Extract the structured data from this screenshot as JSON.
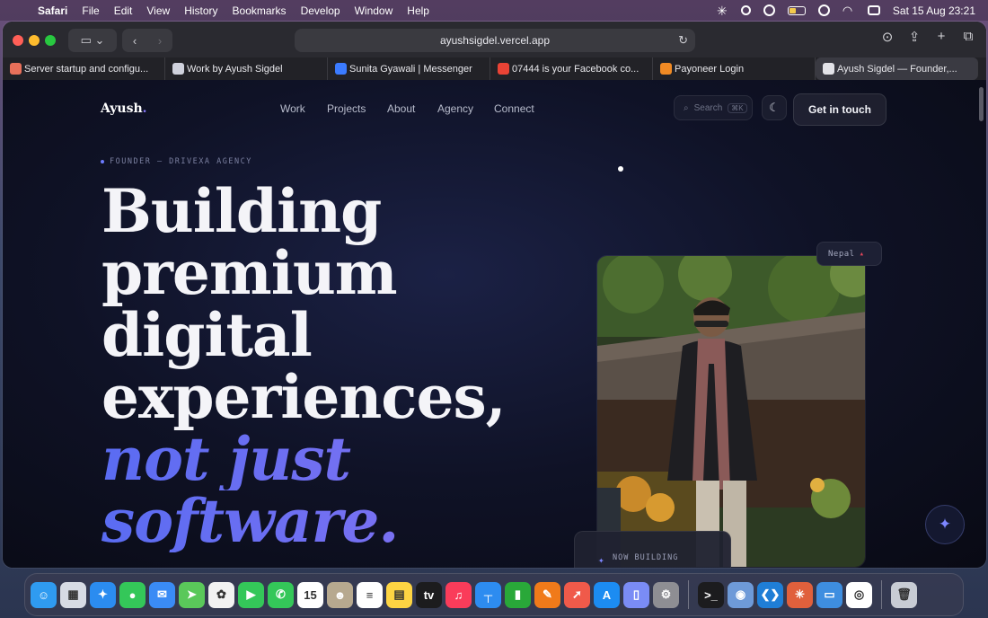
{
  "menubar": {
    "app": "Safari",
    "items": [
      "File",
      "Edit",
      "View",
      "History",
      "Bookmarks",
      "Develop",
      "Window",
      "Help"
    ],
    "clock": "Sat 15 Aug  23:21"
  },
  "browser": {
    "url": "ayushsigdel.vercel.app",
    "tabs": [
      {
        "title": "Server startup and configu...",
        "color": "#e8705a"
      },
      {
        "title": "Work by Ayush Sigdel",
        "color": "#cfd1dc"
      },
      {
        "title": "Sunita Gyawali | Messenger",
        "color": "#3b7bff"
      },
      {
        "title": "07444 is your Facebook co...",
        "color": "#ea4335"
      },
      {
        "title": "Payoneer Login",
        "color": "#f08a24"
      },
      {
        "title": "Ayush Sigdel — Founder,...",
        "color": "#e3e3e8"
      }
    ]
  },
  "site": {
    "logo": "Ayush",
    "logo_dot": ".",
    "nav": [
      "Work",
      "Projects",
      "About",
      "Agency",
      "Connect"
    ],
    "search_placeholder": "Search",
    "search_kbd": "⌘K",
    "cta": "Get in touch",
    "eyebrow": "FOUNDER — DRIVEXA AGENCY",
    "hero": {
      "lines": [
        "Building",
        "premium",
        "digital",
        "experiences,"
      ],
      "accent_lines": [
        "not just",
        "software."
      ]
    },
    "location_badge": "Nepal",
    "now_building": "NOW BUILDING"
  },
  "dock": {
    "apps": [
      {
        "name": "Finder",
        "color": "#2f9bf0",
        "glyph": "☺"
      },
      {
        "name": "Launchpad",
        "color": "#d7dbe4",
        "glyph": "▦"
      },
      {
        "name": "Safari",
        "color": "#2b8cf0",
        "glyph": "✦"
      },
      {
        "name": "Messages",
        "color": "#34c759",
        "glyph": "●"
      },
      {
        "name": "Mail",
        "color": "#3a8bf5",
        "glyph": "✉"
      },
      {
        "name": "Maps",
        "color": "#5ac85a",
        "glyph": "➤"
      },
      {
        "name": "Photos",
        "color": "#f2f2f2",
        "glyph": "✿"
      },
      {
        "name": "FaceTime",
        "color": "#34c759",
        "glyph": "▶"
      },
      {
        "name": "Phone",
        "color": "#34c759",
        "glyph": "✆"
      },
      {
        "name": "Calendar",
        "color": "#ffffff",
        "glyph": "15"
      },
      {
        "name": "Contacts",
        "color": "#b7a98f",
        "glyph": "☻"
      },
      {
        "name": "Reminders",
        "color": "#ffffff",
        "glyph": "≡"
      },
      {
        "name": "Notes",
        "color": "#fdd443",
        "glyph": "▤"
      },
      {
        "name": "TV",
        "color": "#1c1c1e",
        "glyph": "tv"
      },
      {
        "name": "Music",
        "color": "#fa3c5a",
        "glyph": "♫"
      },
      {
        "name": "Keynote",
        "color": "#2d8cf0",
        "glyph": "┬"
      },
      {
        "name": "Numbers",
        "color": "#29a839",
        "glyph": "▮"
      },
      {
        "name": "Pages",
        "color": "#f07a1a",
        "glyph": "✎"
      },
      {
        "name": "Rocket",
        "color": "#f05a4a",
        "glyph": "➚"
      },
      {
        "name": "App Store",
        "color": "#1c8cf2",
        "glyph": "A"
      },
      {
        "name": "Preview",
        "color": "#7a8cf5",
        "glyph": "▯"
      },
      {
        "name": "System Settings",
        "color": "#8e8e93",
        "glyph": "⚙"
      },
      {
        "name": "Terminal",
        "color": "#1c1c1e",
        "glyph": ">_"
      },
      {
        "name": "Disk Utility",
        "color": "#6e9ad8",
        "glyph": "◉"
      },
      {
        "name": "VS Code",
        "color": "#1f7ed6",
        "glyph": "❮❯"
      },
      {
        "name": "Claude",
        "color": "#e0603c",
        "glyph": "✳"
      },
      {
        "name": "Files",
        "color": "#3e8ee0",
        "glyph": "▭"
      },
      {
        "name": "Chrome",
        "color": "#ffffff",
        "glyph": "◎"
      }
    ],
    "trash": {
      "name": "Trash",
      "color": "#c8ccd4",
      "glyph": "🗑"
    }
  }
}
